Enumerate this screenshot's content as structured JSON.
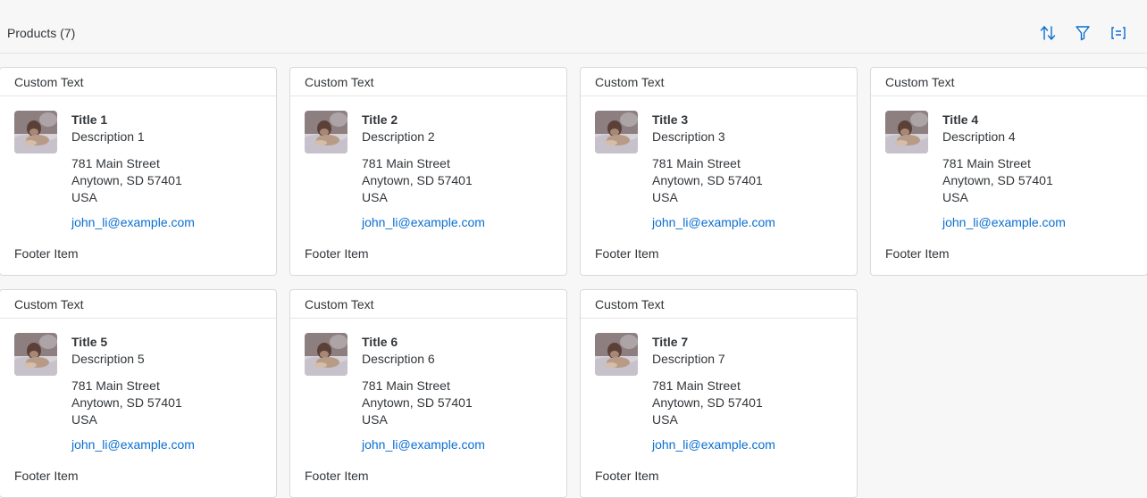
{
  "toolbar": {
    "title": "Products (7)",
    "icons": [
      "sort-icon",
      "filter-icon",
      "group-icon"
    ]
  },
  "theme": {
    "link": "#0a6ed1",
    "text": "#32363a"
  },
  "cards": [
    {
      "header": "Custom Text",
      "title": "Title 1",
      "description": "Description 1",
      "address": [
        "781 Main Street",
        "Anytown, SD 57401",
        "USA"
      ],
      "email": "john_li@example.com",
      "footer": "Footer Item"
    },
    {
      "header": "Custom Text",
      "title": "Title 2",
      "description": "Description 2",
      "address": [
        "781 Main Street",
        "Anytown, SD 57401",
        "USA"
      ],
      "email": "john_li@example.com",
      "footer": "Footer Item"
    },
    {
      "header": "Custom Text",
      "title": "Title 3",
      "description": "Description 3",
      "address": [
        "781 Main Street",
        "Anytown, SD 57401",
        "USA"
      ],
      "email": "john_li@example.com",
      "footer": "Footer Item"
    },
    {
      "header": "Custom Text",
      "title": "Title 4",
      "description": "Description 4",
      "address": [
        "781 Main Street",
        "Anytown, SD 57401",
        "USA"
      ],
      "email": "john_li@example.com",
      "footer": "Footer Item"
    },
    {
      "header": "Custom Text",
      "title": "Title 5",
      "description": "Description 5",
      "address": [
        "781 Main Street",
        "Anytown, SD 57401",
        "USA"
      ],
      "email": "john_li@example.com",
      "footer": "Footer Item"
    },
    {
      "header": "Custom Text",
      "title": "Title 6",
      "description": "Description 6",
      "address": [
        "781 Main Street",
        "Anytown, SD 57401",
        "USA"
      ],
      "email": "john_li@example.com",
      "footer": "Footer Item"
    },
    {
      "header": "Custom Text",
      "title": "Title 7",
      "description": "Description 7",
      "address": [
        "781 Main Street",
        "Anytown, SD 57401",
        "USA"
      ],
      "email": "john_li@example.com",
      "footer": "Footer Item"
    }
  ]
}
